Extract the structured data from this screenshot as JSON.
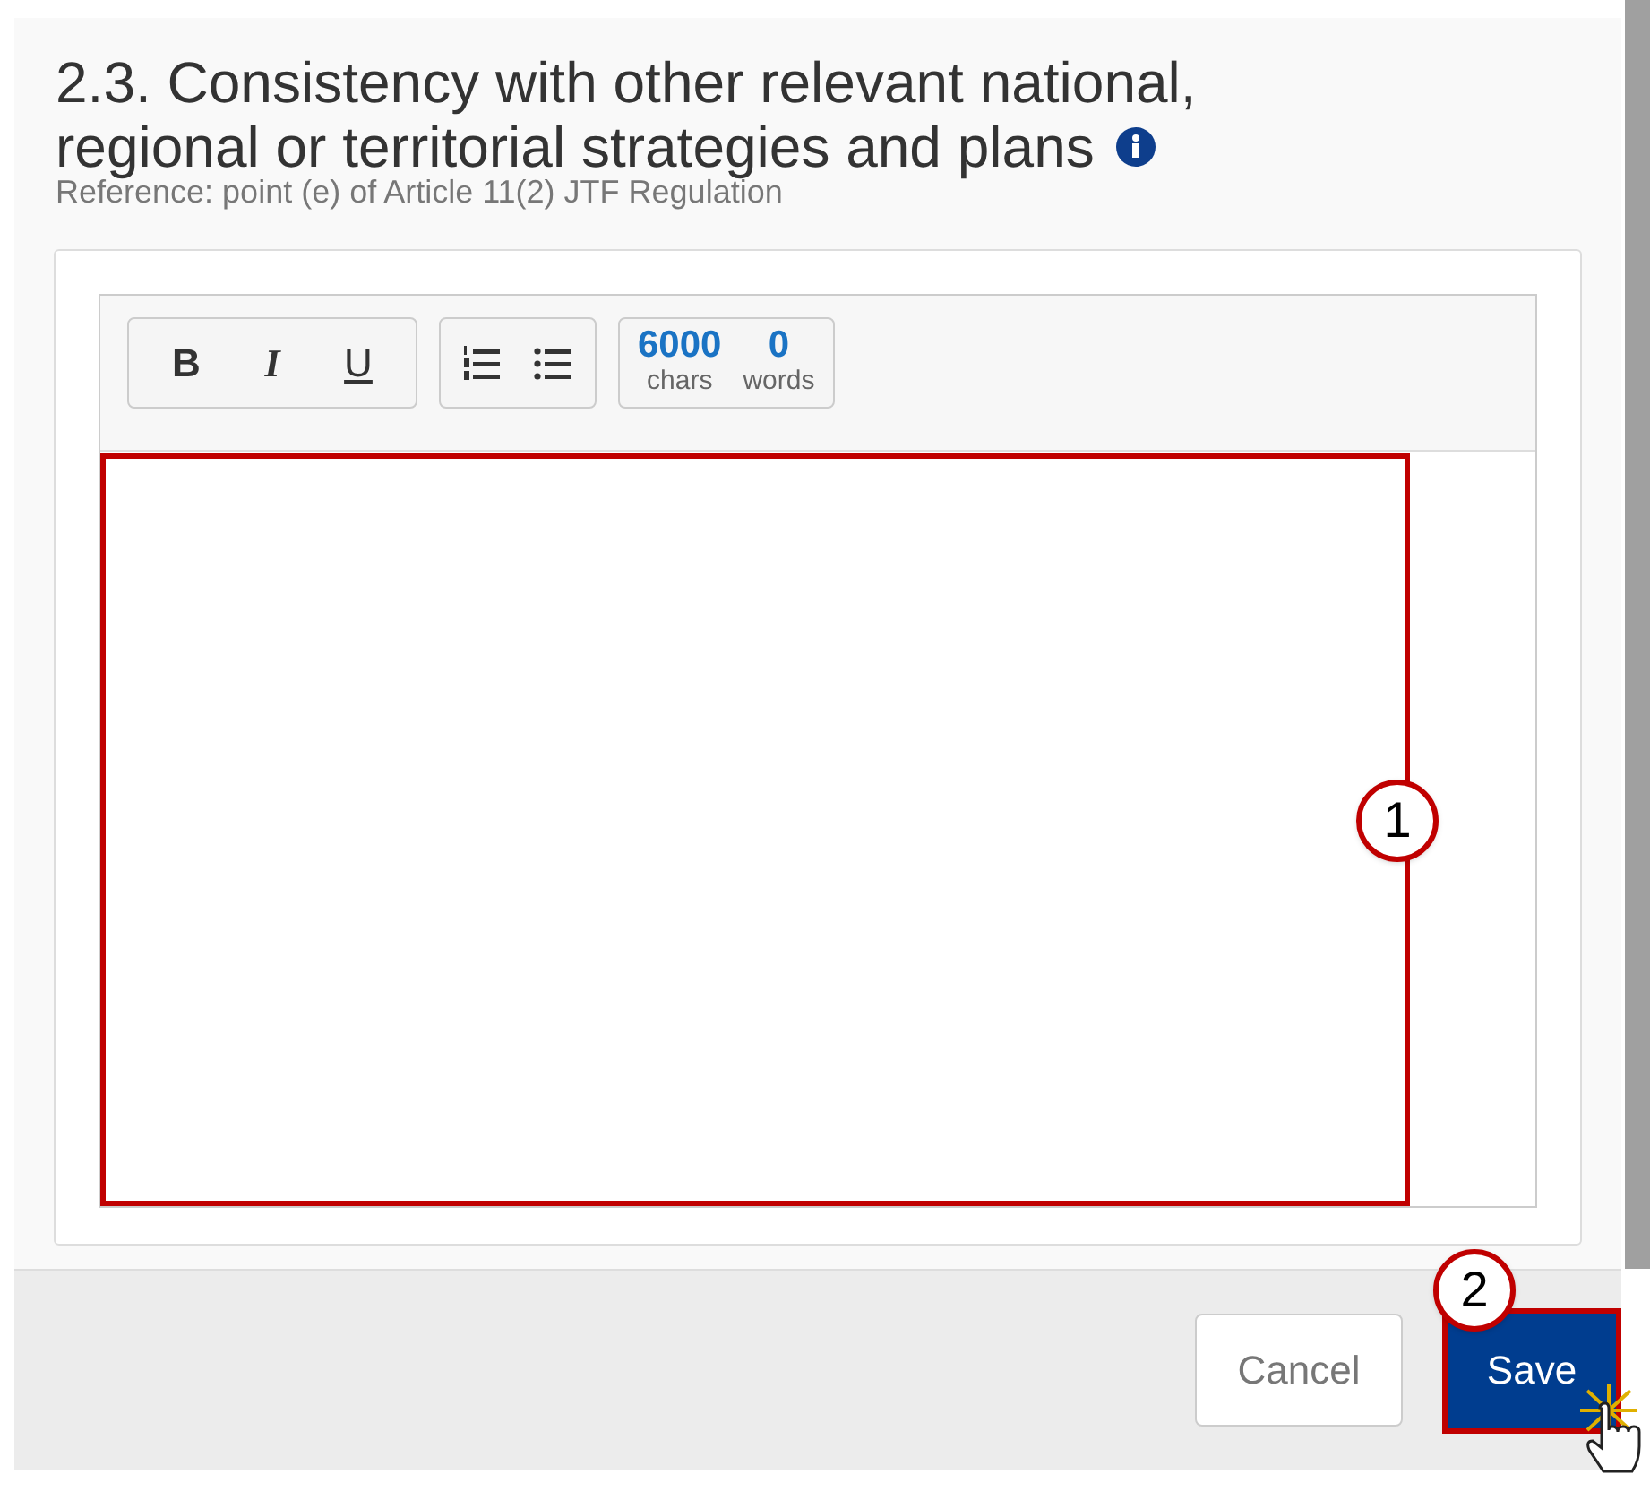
{
  "section": {
    "title": "2.3. Consistency with other relevant national, regional or territorial strategies and plans",
    "reference": "Reference: point (e) of Article 11(2) JTF Regulation"
  },
  "toolbar": {
    "format_buttons": [
      {
        "label": "B",
        "kind": "bold"
      },
      {
        "label": "I",
        "kind": "italic"
      },
      {
        "label": "U",
        "kind": "underline"
      }
    ],
    "list_buttons": [
      {
        "kind": "numbered"
      },
      {
        "kind": "bulleted"
      }
    ],
    "counters": [
      {
        "value": "6000",
        "unit": "chars"
      },
      {
        "value": "0",
        "unit": "words"
      }
    ]
  },
  "editor": {
    "highlighted": true,
    "callout": "1"
  },
  "footer": {
    "cancel": "Cancel",
    "save": "Save",
    "save_highlighted": true,
    "save_callout": "2"
  }
}
